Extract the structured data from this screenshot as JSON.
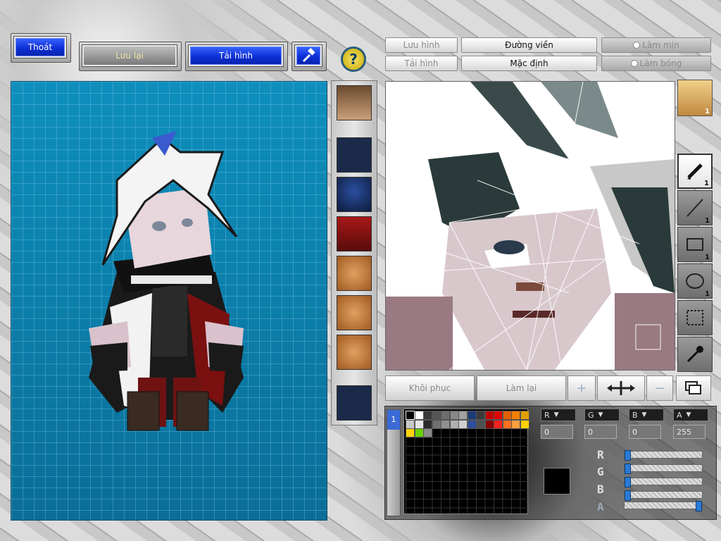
{
  "top_left": {
    "exit_label": "Thoát",
    "save_label": "Lưu lại",
    "load_label": "Tải hình",
    "tool_icon": "hammer-icon",
    "help_icon": "question-mark-icon"
  },
  "parts_strip": {
    "slots": [
      {
        "icon": "character-face-thumb",
        "filled": true
      },
      {
        "icon": "empty-slot",
        "filled": false
      },
      {
        "icon": "helmet-thumb",
        "filled": true
      },
      {
        "icon": "armor-thumb",
        "filled": true
      },
      {
        "icon": "face-angry-thumb",
        "filled": true
      },
      {
        "icon": "face-plain-thumb",
        "filled": true
      },
      {
        "icon": "face-plain-thumb",
        "filled": true
      },
      {
        "icon": "empty-slot",
        "filled": false
      }
    ]
  },
  "editor_toolbar": {
    "save_image": "Lưu hình",
    "load_image": "Tải hình",
    "outline": "Đường viền",
    "default": "Mặc định",
    "smooth": "Làm mịn",
    "shade": "Làm bóng"
  },
  "tools": {
    "avatar_badge": "1",
    "pen_count": "1",
    "line_count": "1",
    "rect_count": "1",
    "ellipse_count": "1"
  },
  "actions": {
    "restore": "Khôi phục",
    "redo": "Làm lại"
  },
  "palette": {
    "tab_number": "1",
    "colors_row1": [
      "#000000",
      "#ffffff",
      "#3a3a3a",
      "#555555",
      "#6e6e6e",
      "#888888",
      "#a0a0a0",
      "#1a3a7a",
      "#3a3a3a",
      "#c00000",
      "#e00000",
      "#e06000",
      "#f08000",
      "#e0a000"
    ],
    "colors_row2": [
      "#c8c8c8",
      "#e6e6e6",
      "#2a2a2a",
      "#707070",
      "#909090",
      "#b0b0b0",
      "#d0d0d0",
      "#2b4f9a",
      "#505050",
      "#8a0000",
      "#ff2020",
      "#ff7020",
      "#ffa040",
      "#ffd000"
    ],
    "colors_row3": [
      "#ffd400",
      "#6ad000",
      "#8a8a8a"
    ],
    "selected_color": "#000000"
  },
  "channels": {
    "r_label": "R",
    "g_label": "G",
    "b_label": "B",
    "a_label": "A",
    "r_value": "0",
    "g_value": "0",
    "b_value": "0",
    "a_value": "255",
    "r_level": 0,
    "g_level": 0,
    "b_level": 0,
    "a_level": 1
  }
}
